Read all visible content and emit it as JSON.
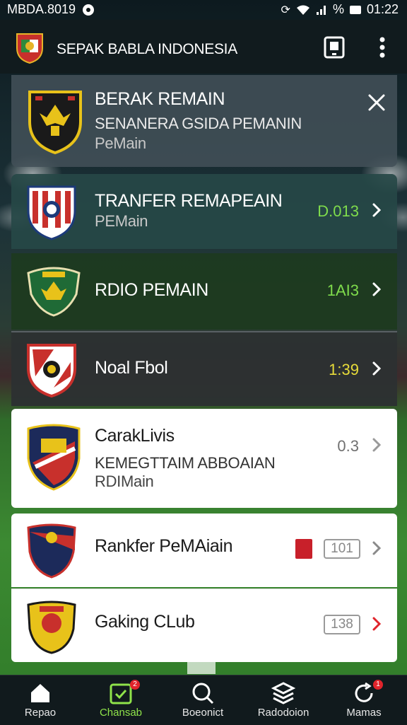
{
  "status_bar": {
    "left_text": "MBDA.8019",
    "signal_text": "%",
    "time": "01:22"
  },
  "app_bar": {
    "title": "SEPAK BABLA INDONESIA",
    "icons": [
      "club-crest-icon",
      "tablet-icon",
      "more-vert-icon"
    ]
  },
  "items": [
    {
      "title": "BERAK REMAIN",
      "subtitle": "SENANERA GSIDA PEMANIN",
      "detail": "PeMain",
      "value": "",
      "action": "close-icon",
      "colors": {
        "crest": "#1a1a1a",
        "accent": "#e8c21a"
      }
    },
    {
      "title": "TRANFER REMAPEAIN",
      "subtitle": "PEMain",
      "detail": "",
      "value": "D.013",
      "value_color": "#7fdc4c",
      "action": "chevron-right-icon"
    },
    {
      "title": "RDIO PEMAIN",
      "subtitle": "",
      "detail": "",
      "value": "1AI3",
      "value_color": "#7fdc4c",
      "action": "chevron-right-icon"
    },
    {
      "title": "Noal Fbol",
      "subtitle": "",
      "detail": "",
      "value": "1:39",
      "value_color": "#e8dc3a",
      "action": "chevron-right-icon"
    },
    {
      "title": "CarakLivis",
      "subtitle": "KEMEGTTAIM ABBOAIAN",
      "detail": "RDIMain",
      "value": "0.3",
      "value_color": "#707070",
      "action": "chevron-right-icon"
    },
    {
      "title": "Rankfer PeMAiain",
      "subtitle": "",
      "detail": "",
      "value": "101",
      "value_color": "#8a8a8a",
      "action": "chevron-right-icon"
    },
    {
      "title": "Gaking CLub",
      "subtitle": "",
      "detail": "",
      "value": "138",
      "value_color": "#8a8a8a",
      "action": "chevron-right-icon",
      "chevron_color": "#e0242b"
    }
  ],
  "bottom_nav": [
    {
      "label": "Repao",
      "icon": "home-icon",
      "active": false
    },
    {
      "label": "Chansab",
      "icon": "calendar-check-icon",
      "active": true,
      "badge": "2"
    },
    {
      "label": "Boeonict",
      "icon": "search-icon",
      "active": false
    },
    {
      "label": "Radodoion",
      "icon": "layers-icon",
      "active": false
    },
    {
      "label": "Mamas",
      "icon": "refresh-icon",
      "active": false,
      "badge": "1"
    }
  ]
}
